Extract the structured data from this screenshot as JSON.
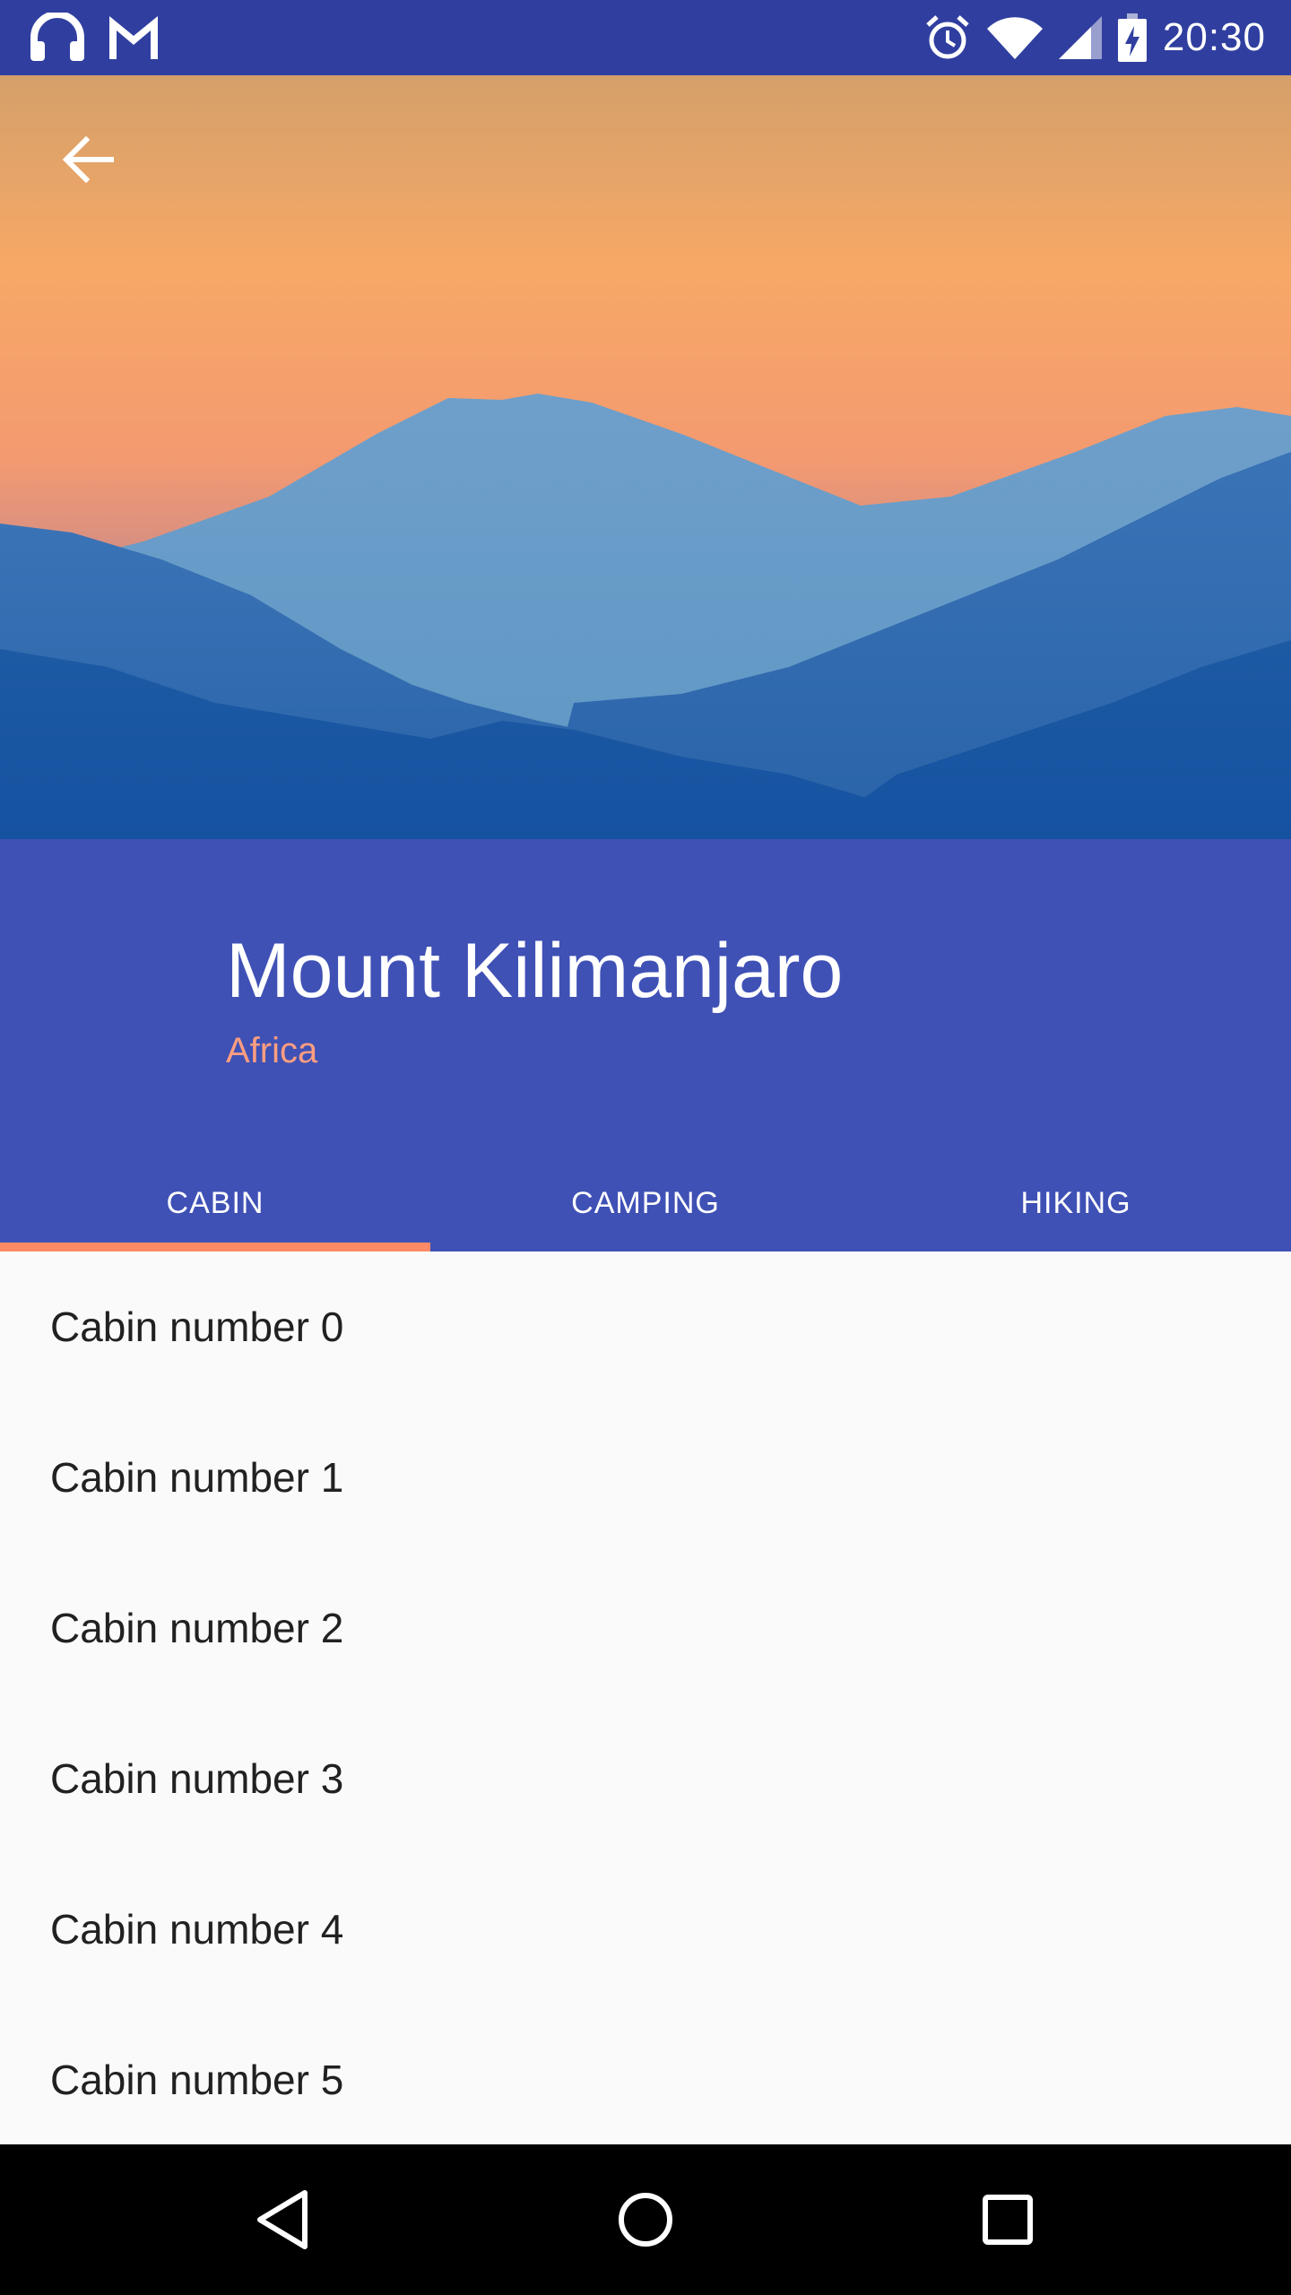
{
  "status_bar": {
    "time": "20:30",
    "icons": [
      "headphones-icon",
      "gmail-icon",
      "alarm-icon",
      "wifi-icon",
      "cell-signal-icon",
      "battery-charging-icon"
    ]
  },
  "app_bar": {
    "back_icon": "arrow-back-icon"
  },
  "header": {
    "title": "Mount Kilimanjaro",
    "subtitle": "Africa",
    "background_color": "#3f51b5",
    "subtitle_color": "#ff9e80"
  },
  "tabs": [
    {
      "label": "CABIN",
      "selected": true
    },
    {
      "label": "CAMPING",
      "selected": false
    },
    {
      "label": "HIKING",
      "selected": false
    }
  ],
  "tab_indicator_color": "#ff8a65",
  "list": {
    "items": [
      "Cabin number 0",
      "Cabin number 1",
      "Cabin number 2",
      "Cabin number 3",
      "Cabin number 4",
      "Cabin number 5"
    ]
  },
  "nav_bar": {
    "buttons": [
      "back-triangle-icon",
      "home-circle-icon",
      "recents-square-icon"
    ]
  }
}
